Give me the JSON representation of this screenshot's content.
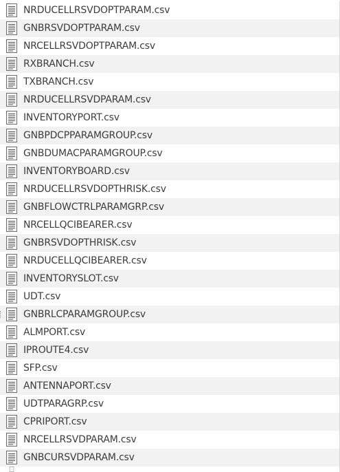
{
  "file_list": {
    "items": [
      {
        "name": "NRDUCELLRSVDOPTPARAM.csv",
        "icon": "text-file-icon"
      },
      {
        "name": "GNBRSVDOPTPARAM.csv",
        "icon": "text-file-icon"
      },
      {
        "name": "NRCELLRSVDOPTPARAM.csv",
        "icon": "text-file-icon"
      },
      {
        "name": "RXBRANCH.csv",
        "icon": "text-file-icon"
      },
      {
        "name": "TXBRANCH.csv",
        "icon": "text-file-icon"
      },
      {
        "name": "NRDUCELLRSVDPARAM.csv",
        "icon": "text-file-icon"
      },
      {
        "name": "INVENTORYPORT.csv",
        "icon": "text-file-icon"
      },
      {
        "name": "GNBPDCPPARAMGROUP.csv",
        "icon": "text-file-icon"
      },
      {
        "name": "GNBDUMACPARAMGROUP.csv",
        "icon": "text-file-icon"
      },
      {
        "name": "INVENTORYBOARD.csv",
        "icon": "text-file-icon"
      },
      {
        "name": "NRDUCELLRSVDOPTHRISK.csv",
        "icon": "text-file-icon"
      },
      {
        "name": "GNBFLOWCTRLPARAMGRP.csv",
        "icon": "text-file-icon"
      },
      {
        "name": "NRCELLQCIBEARER.csv",
        "icon": "text-file-icon"
      },
      {
        "name": "GNBRSVDOPTHRISK.csv",
        "icon": "text-file-icon"
      },
      {
        "name": "NRDUCELLQCIBEARER.csv",
        "icon": "text-file-icon"
      },
      {
        "name": "INVENTORYSLOT.csv",
        "icon": "text-file-icon"
      },
      {
        "name": "UDT.csv",
        "icon": "text-file-icon"
      },
      {
        "name": "GNBRLCPARAMGROUP.csv",
        "icon": "text-file-icon"
      },
      {
        "name": "ALMPORT.csv",
        "icon": "text-file-icon"
      },
      {
        "name": "IPROUTE4.csv",
        "icon": "text-file-icon"
      },
      {
        "name": "SFP.csv",
        "icon": "text-file-icon"
      },
      {
        "name": "ANTENNAPORT.csv",
        "icon": "text-file-icon"
      },
      {
        "name": "UDTPARAGRP.csv",
        "icon": "text-file-icon"
      },
      {
        "name": "CPRIPORT.csv",
        "icon": "text-file-icon"
      },
      {
        "name": "NRCELLRSVDPARAM.csv",
        "icon": "text-file-icon"
      },
      {
        "name": "GNBCURSVDPARAM.csv",
        "icon": "text-file-icon"
      }
    ]
  },
  "colors": {
    "row_alt_bg": "#f2f2f2",
    "text": "#3c3c3c",
    "icon_border": "#6b6b6b"
  }
}
